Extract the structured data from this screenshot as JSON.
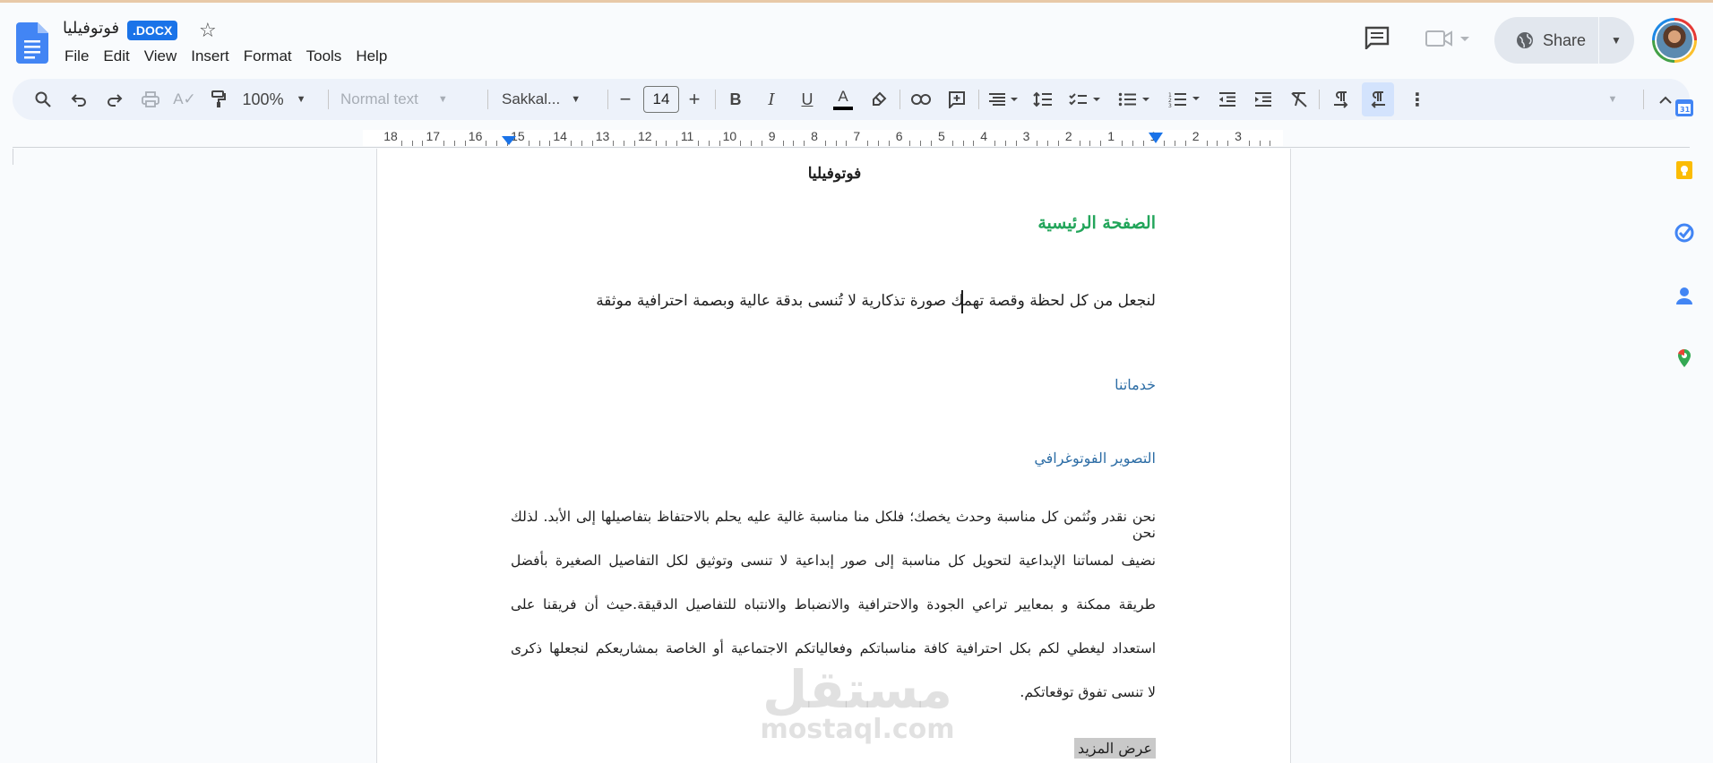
{
  "doc": {
    "title": "فوتوفيليا",
    "badge": ".DOCX"
  },
  "menu": [
    "File",
    "Edit",
    "View",
    "Insert",
    "Format",
    "Tools",
    "Help"
  ],
  "share": {
    "label": "Share"
  },
  "toolbar": {
    "zoom": "100%",
    "style": "Normal text",
    "font": "Sakkal...",
    "font_size": "14",
    "bold": "B",
    "italic": "I",
    "underline": "U",
    "text_color": "A"
  },
  "ruler": {
    "numbers": [
      "18",
      "17",
      "16",
      "15",
      "14",
      "13",
      "12",
      "11",
      "10",
      "9",
      "8",
      "7",
      "6",
      "5",
      "4",
      "3",
      "2",
      "1",
      "1",
      "2",
      "3"
    ]
  },
  "content": {
    "heading": "فوتوفيليا",
    "title": "الصفحة الرئيسية",
    "tagline": "لنجعل من كل لحظة وقصة تهمك صورة تذكارية لا تُنسى بدقة عالية وبصمة احترافية موثقة",
    "services": "خدماتنا",
    "photography": "التصوير الفوتوغرافي",
    "paragraph_lines": [
      "نحن نقدر ونُثمن كل مناسبة وحدث يخصك؛ فلكل منا مناسبة غالية عليه يحلم بالاحتفاظ بتفاصيلها إلى الأبد. لذلك نحن",
      "نضيف لمساتنا الإبداعية لتحويل كل مناسبة إلى صور إبداعية لا تنسى وتوثيق لكل التفاصيل الصغيرة بأفضل",
      "طريقة ممكنة و بمعايير تراعي الجودة والاحترافية والانضباط والانتباه للتفاصيل الدقيقة.حيث أن فريقنا على",
      "استعداد ليغطي لكم بكل احترافية كافة مناسباتكم وفعالياتكم الاجتماعية أو الخاصة بمشاريعكم لنجعلها ذكرى",
      "لا تنسى تفوق توقعاتكم."
    ],
    "more": "عرض المزيد"
  },
  "watermark": {
    "arabic": "مستقل",
    "latin": "mostaql.com"
  },
  "colors": {
    "accent": "#1a73e8",
    "heading_green": "#22a55a",
    "subheading_blue": "#2e6ea6"
  }
}
